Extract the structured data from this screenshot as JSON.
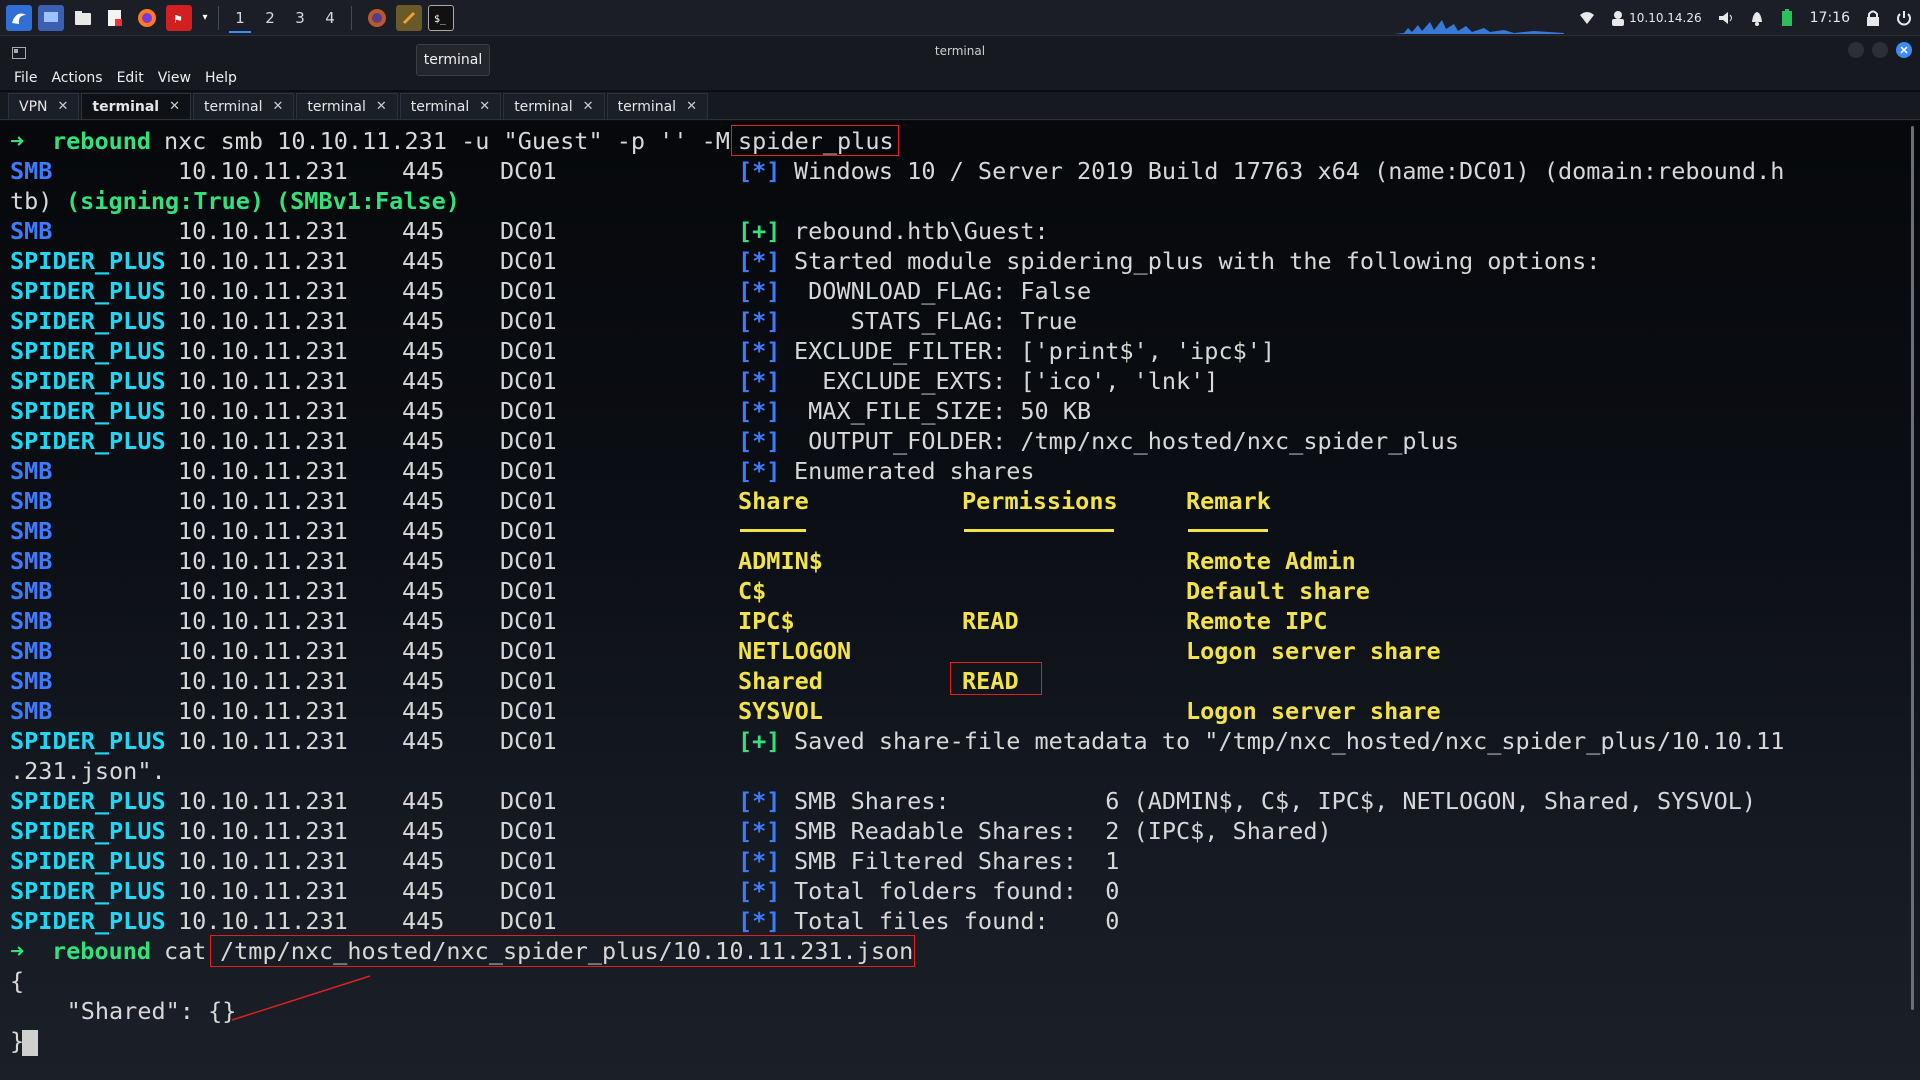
{
  "topbar": {
    "workspaces": [
      "1",
      "2",
      "3",
      "4"
    ],
    "ip": "10.10.14.26",
    "time": "17:16"
  },
  "window": {
    "title": "terminal",
    "tooltip": "terminal"
  },
  "menu": [
    "File",
    "Actions",
    "Edit",
    "View",
    "Help"
  ],
  "tabs": [
    {
      "label": "VPN",
      "active": false
    },
    {
      "label": "terminal",
      "active": true
    },
    {
      "label": "terminal",
      "active": false
    },
    {
      "label": "terminal",
      "active": false
    },
    {
      "label": "terminal",
      "active": false
    },
    {
      "label": "terminal",
      "active": false
    },
    {
      "label": "terminal",
      "active": false
    }
  ],
  "colors": {
    "accent": "#3d8bfd",
    "smb": "#3e7bff",
    "spider": "#1fd8f5",
    "green": "#33e07c",
    "yellow": "#f2e34a",
    "highlight": "#e02020"
  },
  "term": {
    "arrow": "➜",
    "host": "rebound",
    "cmd1": "nxc smb 10.10.11.231 -u \"Guest\" -p '' -M ",
    "cmd1_mod": "spider_plus",
    "ip": "10.10.11.231",
    "port": "445",
    "dc": "DC01",
    "smb_tag": "SMB",
    "spider_tag": "SPIDER_PLUS",
    "os_info": "Windows 10 / Server 2019 Build 17763 x64 (name:DC01) (domain:rebound.h",
    "os_cont": "tb) ",
    "signing": "(signing:True)",
    "smbv1": "(SMBv1:False)",
    "guest": "rebound.htb\\Guest:",
    "mark_star": "[*]",
    "mark_plus": "[+]",
    "module_lines": [
      "Started module spidering_plus with the following options:",
      " DOWNLOAD_FLAG: False",
      "    STATS_FLAG: True",
      "EXCLUDE_FILTER: ['print$', 'ipc$']",
      "  EXCLUDE_EXTS: ['ico', 'lnk']",
      " MAX_FILE_SIZE: 50 KB",
      " OUTPUT_FOLDER: /tmp/nxc_hosted/nxc_spider_plus"
    ],
    "enumerated": "Enumerated shares",
    "share_headers": {
      "share": "Share",
      "perm": "Permissions",
      "remark": "Remark"
    },
    "shares": [
      {
        "name": "ADMIN$",
        "perm": "",
        "remark": "Remote Admin"
      },
      {
        "name": "C$",
        "perm": "",
        "remark": "Default share"
      },
      {
        "name": "IPC$",
        "perm": "READ",
        "remark": "Remote IPC"
      },
      {
        "name": "NETLOGON",
        "perm": "",
        "remark": "Logon server share"
      },
      {
        "name": "Shared",
        "perm": "READ",
        "remark": ""
      },
      {
        "name": "SYSVOL",
        "perm": "",
        "remark": "Logon server share"
      }
    ],
    "saved": "Saved share-file metadata to \"/tmp/nxc_hosted/nxc_spider_plus/10.10.11",
    "saved_cont": ".231.json\".",
    "stats": [
      "SMB Shares:           6 (ADMIN$, C$, IPC$, NETLOGON, Shared, SYSVOL)",
      "SMB Readable Shares:  2 (IPC$, Shared)",
      "SMB Filtered Shares:  1",
      "Total folders found:  0",
      "Total files found:    0"
    ],
    "cmd2": "cat ",
    "cmd2_path": "/tmp/nxc_hosted/nxc_spider_plus/10.10.11.231.json",
    "json_open": "{",
    "json_body": "    \"Shared\": {}",
    "json_close": "}"
  }
}
